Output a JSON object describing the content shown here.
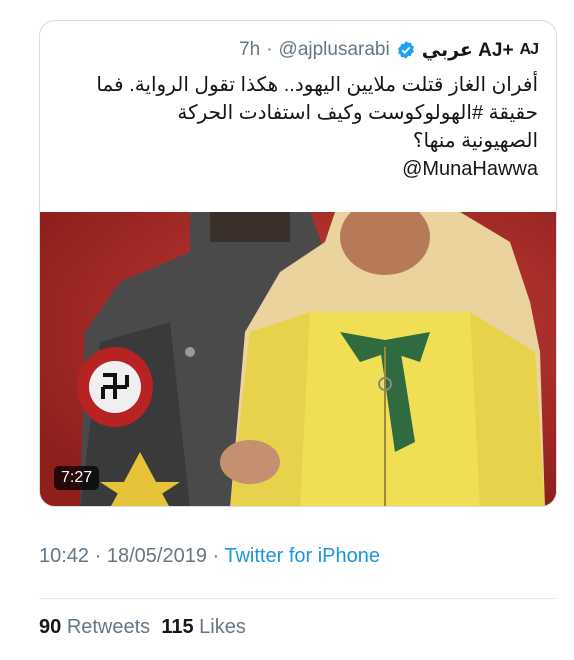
{
  "tweet": {
    "display_name": "عربي AJ+",
    "logo_text": "AJ",
    "handle": "@ajplusarabi",
    "separator": "·",
    "time_ago": "7h",
    "text_lines": [
      "أفران الغاز قتلت ملايين اليهود.. هكذا تقول الرواية. فما",
      "حقيقة #الهولوكوست وكيف استفادت الحركة",
      "الصهيونية منها؟"
    ],
    "mention": "@MunaHawwa",
    "video_duration": "7:27"
  },
  "meta": {
    "time": "10:42",
    "sep1": " · ",
    "date": "18/05/2019",
    "sep2": " · ",
    "source": "Twitter for iPhone"
  },
  "stats": {
    "retweets_count": "90",
    "retweets_label": "Retweets",
    "likes_count": "115",
    "likes_label": "Likes"
  },
  "colors": {
    "verified": "#1da1f2",
    "link": "#1b95e0",
    "muted": "#657786",
    "media_background": "#b52f2c"
  }
}
